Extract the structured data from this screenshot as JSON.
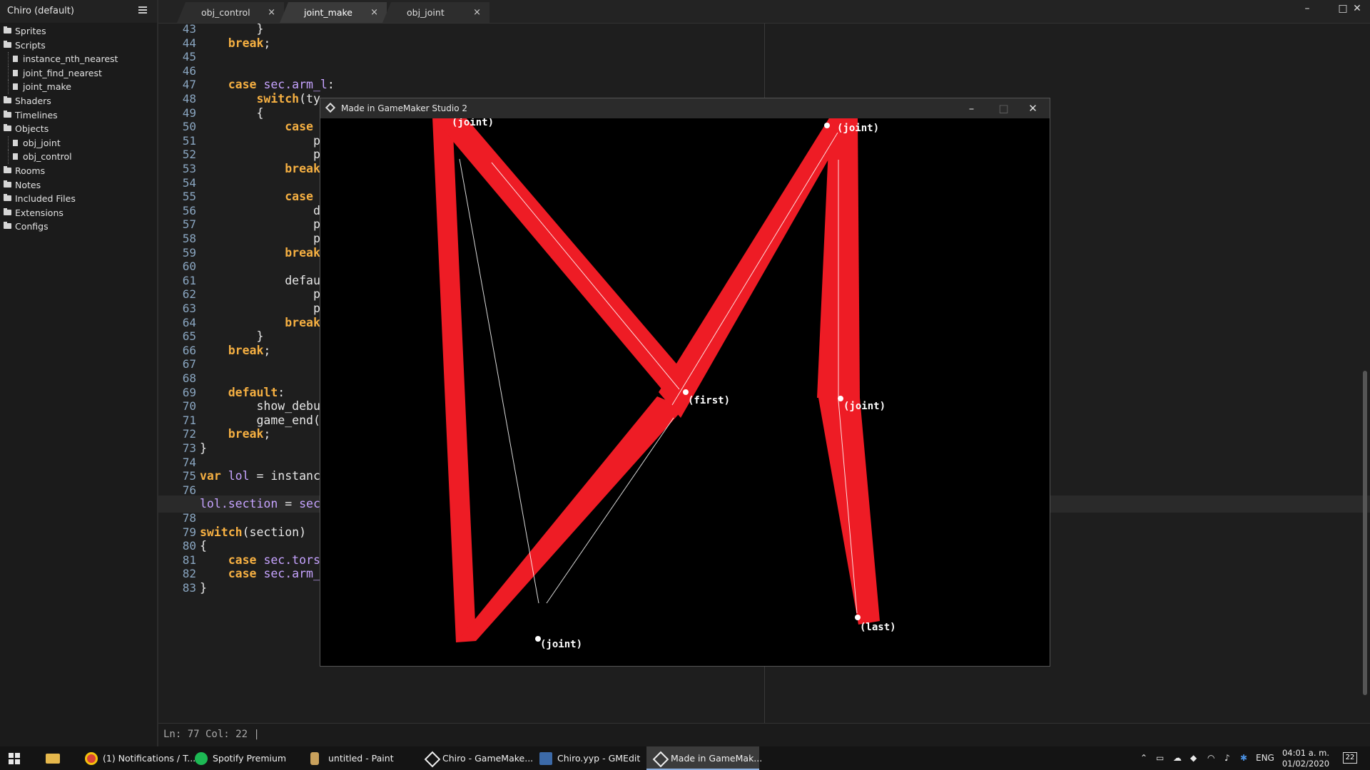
{
  "sidebar": {
    "title": "Chiro (default)",
    "tree": [
      {
        "label": "Sprites",
        "level": 0
      },
      {
        "label": "Scripts",
        "level": 0
      },
      {
        "label": "instance_nth_nearest",
        "level": 1
      },
      {
        "label": "joint_find_nearest",
        "level": 1
      },
      {
        "label": "joint_make",
        "level": 1
      },
      {
        "label": "Shaders",
        "level": 0
      },
      {
        "label": "Timelines",
        "level": 0
      },
      {
        "label": "Objects",
        "level": 0
      },
      {
        "label": "obj_joint",
        "level": 1
      },
      {
        "label": "obj_control",
        "level": 1
      },
      {
        "label": "Rooms",
        "level": 0
      },
      {
        "label": "Notes",
        "level": 0
      },
      {
        "label": "Included Files",
        "level": 0
      },
      {
        "label": "Extensions",
        "level": 0
      },
      {
        "label": "Configs",
        "level": 0
      }
    ]
  },
  "tabs": [
    {
      "label": "obj_control",
      "close": "×",
      "active": false
    },
    {
      "label": "joint_make",
      "close": "×",
      "active": true
    },
    {
      "label": "obj_joint",
      "close": "×",
      "active": false
    }
  ],
  "window_controls": {
    "minimize": "–",
    "maximize": "□",
    "close": "✕"
  },
  "editor": {
    "cursor_line": 77,
    "lines": [
      {
        "n": "43",
        "t": "        }"
      },
      {
        "n": "44",
        "t": "    break;"
      },
      {
        "n": "45",
        "t": ""
      },
      {
        "n": "46",
        "t": ""
      },
      {
        "n": "47",
        "t": "    case sec.arm_l:"
      },
      {
        "n": "48",
        "t": "        switch(ty"
      },
      {
        "n": "49",
        "t": "        {"
      },
      {
        "n": "50",
        "t": "            case"
      },
      {
        "n": "51",
        "t": "                p"
      },
      {
        "n": "52",
        "t": "                p"
      },
      {
        "n": "53",
        "t": "            break"
      },
      {
        "n": "54",
        "t": ""
      },
      {
        "n": "55",
        "t": "            case"
      },
      {
        "n": "56",
        "t": "                d"
      },
      {
        "n": "57",
        "t": "                p"
      },
      {
        "n": "58",
        "t": "                p"
      },
      {
        "n": "59",
        "t": "            break"
      },
      {
        "n": "60",
        "t": ""
      },
      {
        "n": "61",
        "t": "            defau"
      },
      {
        "n": "62",
        "t": "                p"
      },
      {
        "n": "63",
        "t": "                p"
      },
      {
        "n": "64",
        "t": "            break"
      },
      {
        "n": "65",
        "t": "        }"
      },
      {
        "n": "66",
        "t": "    break;"
      },
      {
        "n": "67",
        "t": ""
      },
      {
        "n": "68",
        "t": ""
      },
      {
        "n": "69",
        "t": "    default:"
      },
      {
        "n": "70",
        "t": "        show_debu"
      },
      {
        "n": "71",
        "t": "        game_end("
      },
      {
        "n": "72",
        "t": "    break;"
      },
      {
        "n": "73",
        "t": "}"
      },
      {
        "n": "74",
        "t": ""
      },
      {
        "n": "75",
        "t": "var lol = instanc"
      },
      {
        "n": "76",
        "t": ""
      },
      {
        "n": "77",
        "t": "lol.section = sec"
      },
      {
        "n": "78",
        "t": ""
      },
      {
        "n": "79",
        "t": "switch(section)"
      },
      {
        "n": "80",
        "t": "{"
      },
      {
        "n": "81",
        "t": "    case sec.torso: break;"
      },
      {
        "n": "82",
        "t": "    case sec.arm_l: lol.image_blend = c_aqua; break;"
      },
      {
        "n": "83",
        "t": "}"
      }
    ],
    "partial_line": "44"
  },
  "statusbar": {
    "text": "Ln:   77 Col:   22 |"
  },
  "game_window": {
    "title": "Made in GameMaker Studio 2",
    "controls": {
      "minimize": "–",
      "maximize": "□",
      "close": "✕"
    },
    "labels": [
      "(joint)",
      "(joint)",
      "(first)",
      "(joint)",
      "(last)",
      "(joint)"
    ],
    "colors": {
      "limb": "#ee1c25",
      "line": "#ffffff",
      "background": "#000000"
    }
  },
  "taskbar": {
    "items": [
      {
        "label": "(1) Notifications / T...",
        "icon": "chrome-icon"
      },
      {
        "label": "Spotify Premium",
        "icon": "spotify-icon"
      },
      {
        "label": "untitled - Paint",
        "icon": "paint-icon"
      },
      {
        "label": "Chiro - GameMake...",
        "icon": "gamemaker-icon"
      },
      {
        "label": "Chiro.yyp - GMEdit",
        "icon": "gmedit-icon"
      },
      {
        "label": "Made in GameMak...",
        "icon": "gamemaker-icon"
      }
    ],
    "language": "ENG",
    "time": "04:01 a. m.",
    "date": "01/02/2020",
    "notifications": "22"
  }
}
